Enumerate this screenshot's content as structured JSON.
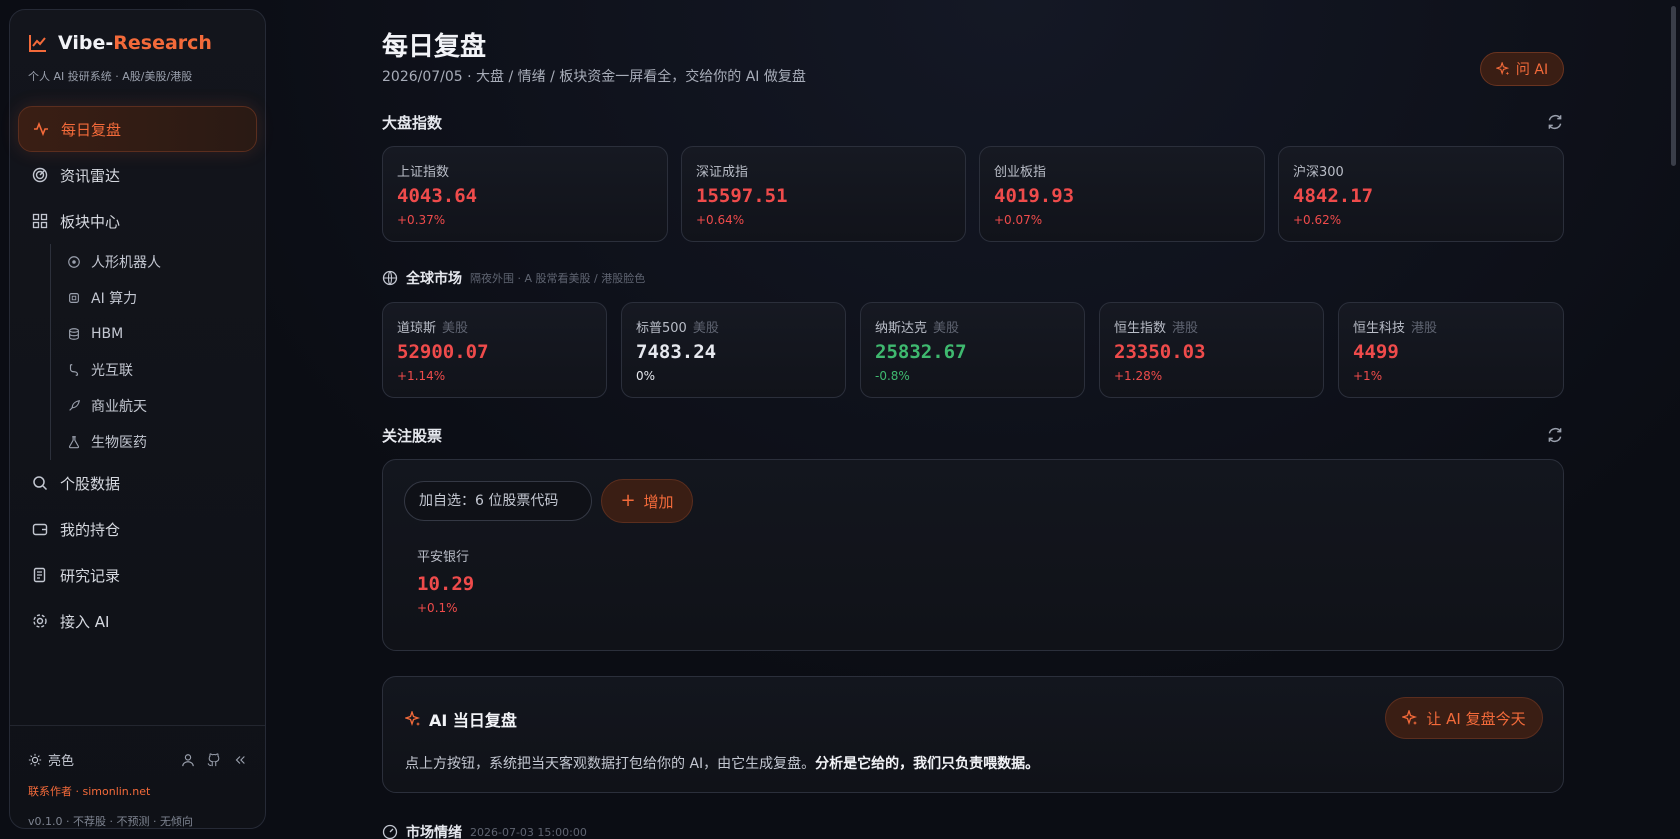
{
  "brand": {
    "name_part1": "Vibe-",
    "name_part2": "Research",
    "subtitle": "个人 AI 投研系统 · A股/美股/港股"
  },
  "nav": {
    "items": [
      {
        "label": "每日复盘",
        "icon": "activity-icon",
        "active": true
      },
      {
        "label": "资讯雷达",
        "icon": "radar-icon"
      },
      {
        "label": "板块中心",
        "icon": "grid-icon"
      }
    ],
    "sub_items": [
      {
        "label": "人形机器人",
        "icon": "robot-icon"
      },
      {
        "label": "AI 算力",
        "icon": "chip-icon"
      },
      {
        "label": "HBM",
        "icon": "database-icon"
      },
      {
        "label": "光互联",
        "icon": "cable-icon"
      },
      {
        "label": "商业航天",
        "icon": "rocket-icon"
      },
      {
        "label": "生物医药",
        "icon": "flask-icon"
      }
    ],
    "items2": [
      {
        "label": "个股数据",
        "icon": "search-icon"
      },
      {
        "label": "我的持仓",
        "icon": "wallet-icon"
      },
      {
        "label": "研究记录",
        "icon": "notebook-icon"
      },
      {
        "label": "接入 AI",
        "icon": "gear-icon"
      }
    ]
  },
  "footer": {
    "theme_label": "亮色",
    "contact": "联系作者 · simonlin.net",
    "version": "v0.1.0 · 不荐股 · 不预测 · 无倾向"
  },
  "header": {
    "title": "每日复盘",
    "subtitle": "2026/07/05 · 大盘 / 情绪 / 板块资金一屏看全，交给你的 AI 做复盘",
    "ask_label": "问 AI"
  },
  "indices": {
    "title": "大盘指数",
    "cards": [
      {
        "name": "上证指数",
        "value": "4043.64",
        "change": "+0.37%"
      },
      {
        "name": "深证成指",
        "value": "15597.51",
        "change": "+0.64%"
      },
      {
        "name": "创业板指",
        "value": "4019.93",
        "change": "+0.07%"
      },
      {
        "name": "沪深300",
        "value": "4842.17",
        "change": "+0.62%"
      }
    ]
  },
  "global": {
    "title": "全球市场",
    "note": "隔夜外围 · A 股常看美股 / 港股脸色",
    "cards": [
      {
        "name": "道琼斯",
        "market": "美股",
        "value": "52900.07",
        "change": "+1.14%",
        "trend": "up"
      },
      {
        "name": "标普500",
        "market": "美股",
        "value": "7483.24",
        "change": "0%",
        "trend": "flat"
      },
      {
        "name": "纳斯达克",
        "market": "美股",
        "value": "25832.67",
        "change": "-0.8%",
        "trend": "down"
      },
      {
        "name": "恒生指数",
        "market": "港股",
        "value": "23350.03",
        "change": "+1.28%",
        "trend": "up"
      },
      {
        "name": "恒生科技",
        "market": "港股",
        "value": "4499",
        "change": "+1%",
        "trend": "up"
      }
    ]
  },
  "watchlist": {
    "title": "关注股票",
    "input_placeholder": "加自选：6 位股票代码",
    "add_label": "增加",
    "stocks": [
      {
        "name": "平安银行",
        "value": "10.29",
        "change": "+0.1%"
      }
    ]
  },
  "ai_review": {
    "title": "AI 当日复盘",
    "button_label": "让 AI 复盘今天",
    "desc_plain": "点上方按钮，系统把当天客观数据打包给你的 AI，由它生成复盘。",
    "desc_bold": "分析是它给的，我们只负责喂数据。"
  },
  "sentiment": {
    "title": "市场情绪",
    "timestamp": "2026-07-03 15:00:00"
  },
  "colors": {
    "accent": "#f36a3a",
    "up": "#ef4b4b",
    "down": "#3fb96f",
    "background": "#0b0d14"
  }
}
